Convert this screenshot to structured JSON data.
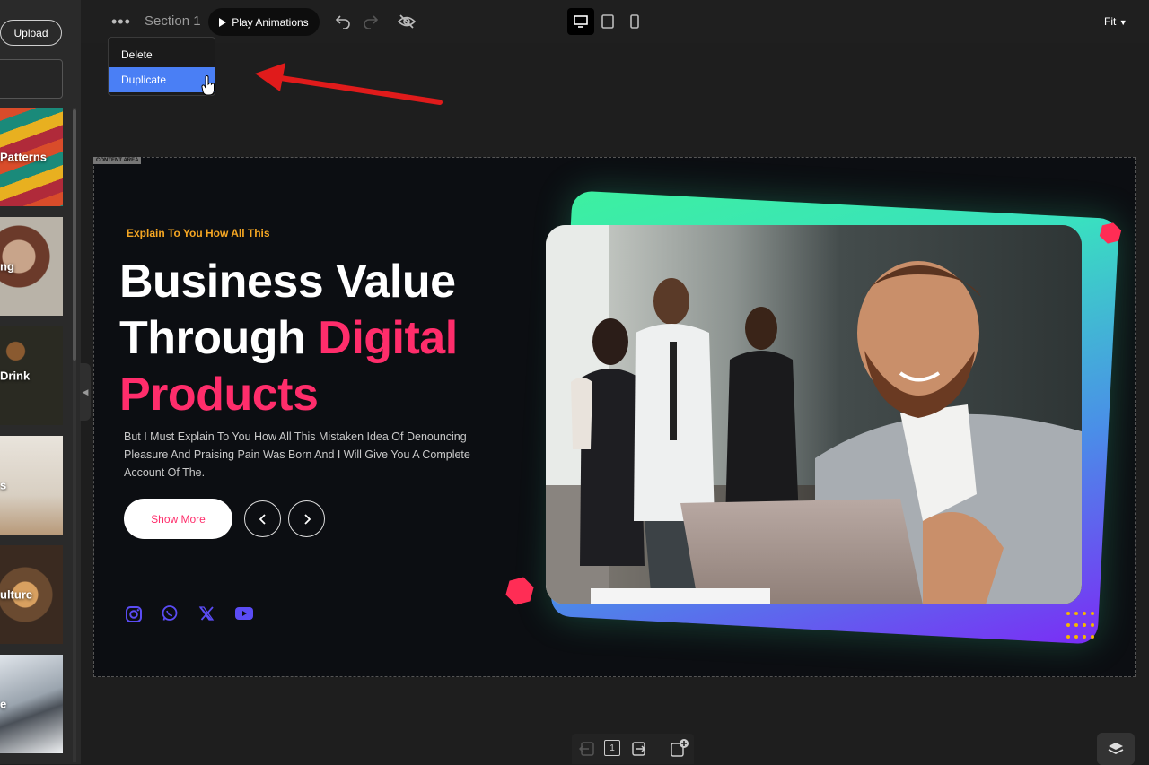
{
  "sidebar": {
    "upload_label": "Upload",
    "thumbnails": [
      {
        "label": "Patterns"
      },
      {
        "label": "ng"
      },
      {
        "label": "Drink"
      },
      {
        "label": "s"
      },
      {
        "label": "ulture"
      },
      {
        "label": "e"
      }
    ]
  },
  "toolbar": {
    "section_title": "Section 1",
    "play_label": "Play Animations",
    "zoom_label": "Fit"
  },
  "menu": {
    "items": [
      {
        "label": "Delete"
      },
      {
        "label": "Duplicate"
      }
    ]
  },
  "canvas": {
    "area_label": "CONTENT AREA",
    "eyebrow": "Explain To You How All This",
    "headline_line1": "Business Value",
    "headline_line2_white": "Through ",
    "headline_line2_pink": "Digital",
    "headline_line3": "Products",
    "paragraph": "But I Must Explain To You How All This Mistaken Idea Of Denouncing Pleasure And Praising Pain Was Born And I Will Give You A Complete Account Of The.",
    "cta_label": "Show More"
  },
  "colors": {
    "accent_pink": "#ff2d6b",
    "eyebrow_orange": "#f5a623",
    "social_blue": "#5b4cf5",
    "menu_highlight": "#4a7ff5",
    "arrow_red": "#e01b1b"
  },
  "bottom": {
    "page_number": "1"
  }
}
